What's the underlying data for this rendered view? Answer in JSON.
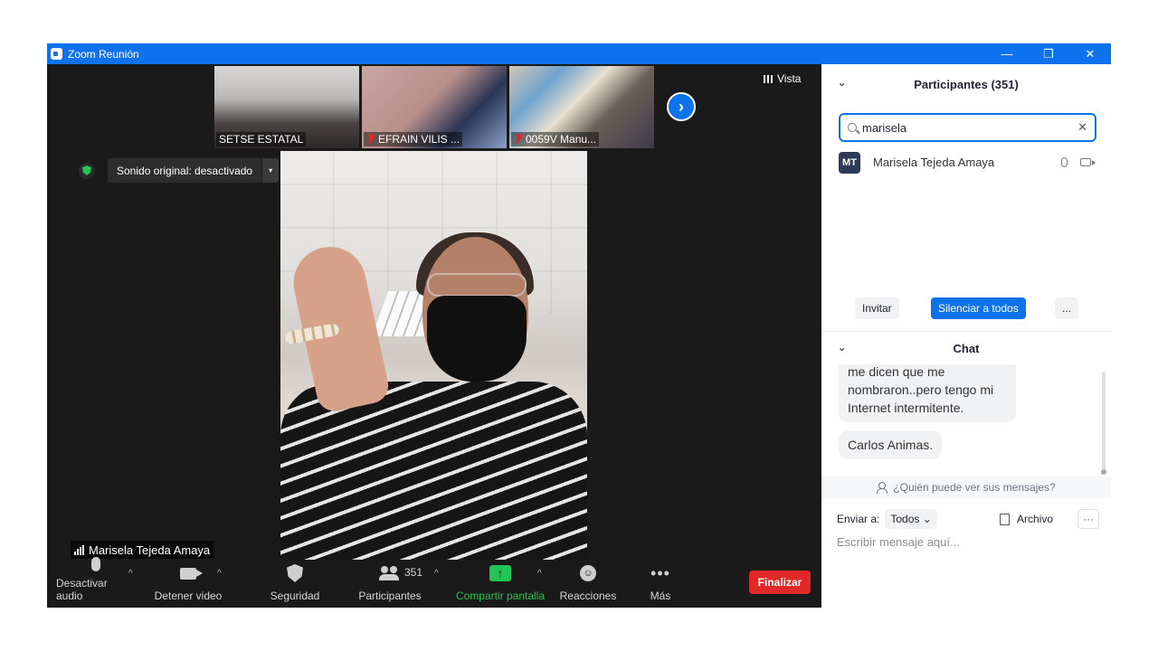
{
  "window": {
    "title": "Zoom Reunión",
    "controls": {
      "minimize": "—",
      "restore": "❐",
      "close": "✕"
    }
  },
  "gallery": {
    "thumbnails": [
      {
        "name": "SETSE ESTATAL",
        "muted": false
      },
      {
        "name": "EFRAIN VILIS ...",
        "muted": true
      },
      {
        "name": "0059V Manu...",
        "muted": true
      }
    ],
    "next_arrow": "›",
    "view_label": "Vista"
  },
  "audio": {
    "original_sound": "Sonido original: desactivado",
    "dropdown": "▾"
  },
  "active_speaker": {
    "name": "Marisela Tejeda Amaya"
  },
  "toolbar": {
    "mute_label": "Desactivar audio",
    "video_label": "Detener video",
    "security_label": "Seguridad",
    "participants_label": "Participantes",
    "participants_count": "351",
    "share_label": "Compartir pantalla",
    "reactions_label": "Reacciones",
    "more_label": "Más",
    "end_label": "Finalizar",
    "caret": "^",
    "share_arrow": "↑",
    "smile": "☺",
    "dots": "•••"
  },
  "participants_panel": {
    "title": "Participantes (351)",
    "collapse": "⌄",
    "search_value": "marisela",
    "clear": "✕",
    "results": [
      {
        "initials": "MT",
        "name": "Marisela Tejeda Amaya"
      }
    ],
    "invite_label": "Invitar",
    "mute_all_label": "Silenciar a todos",
    "more_label": "..."
  },
  "chat": {
    "title": "Chat",
    "collapse": "⌄",
    "messages": [
      "me dicen que me nombraron..pero tengo mi Internet intermitente.",
      "Carlos Animas."
    ],
    "who_can_see": "¿Quién puede ver sus mensajes?",
    "send_to_label": "Enviar a:",
    "send_to_value": "Todos ⌄",
    "file_label": "Archivo",
    "more": "···",
    "input_placeholder": "Escribir mensaje aquí..."
  },
  "colors": {
    "accent": "#0e72ed",
    "danger": "#e02828",
    "share_green": "#23c552"
  }
}
